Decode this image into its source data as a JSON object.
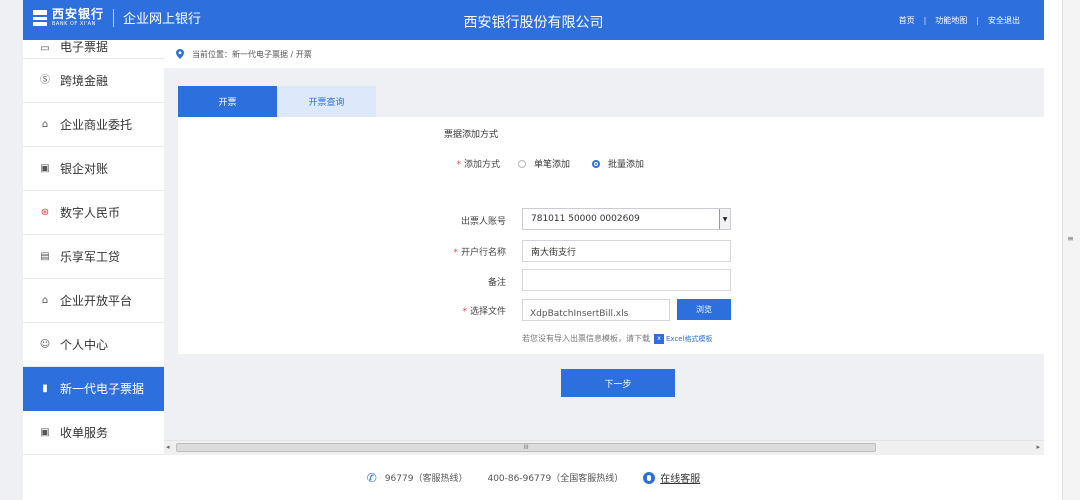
{
  "header": {
    "bank_name_cn": "西安银行",
    "bank_name_en": "BANK OF XI'AN",
    "portal_name": "企业网上银行",
    "company_name": "西安银行股份有限公司",
    "links": {
      "home": "首页",
      "sitemap": "功能地图",
      "logout": "安全退出"
    },
    "accent_color": "#2e6fde"
  },
  "sidebar": {
    "items": [
      {
        "label": "电子票据",
        "icon": "ticket-icon",
        "partial": true
      },
      {
        "label": "跨境金融",
        "icon": "dollar-circle-icon"
      },
      {
        "label": "企业商业委托",
        "icon": "bank-icon"
      },
      {
        "label": "银企对账",
        "icon": "chart-icon"
      },
      {
        "label": "数字人民币",
        "icon": "yuan-coin-icon"
      },
      {
        "label": "乐享军工贷",
        "icon": "card-icon"
      },
      {
        "label": "企业开放平台",
        "icon": "building-icon"
      },
      {
        "label": "个人中心",
        "icon": "user-icon"
      },
      {
        "label": "新一代电子票据",
        "icon": "bill-icon",
        "active": true
      },
      {
        "label": "收单服务",
        "icon": "receipt-icon"
      }
    ]
  },
  "breadcrumb": {
    "text": "当前位置：新一代电子票据 / 开票"
  },
  "tabs": [
    {
      "label": "开票",
      "active": true
    },
    {
      "label": "开票查询",
      "active": false
    }
  ],
  "form": {
    "section_title": "票据添加方式",
    "add_method_label": "添加方式",
    "add_method_options": [
      {
        "label": "单笔添加",
        "checked": false
      },
      {
        "label": "批量添加",
        "checked": true
      }
    ],
    "drawer_account_label": "出票人账号",
    "drawer_account_value": "781011 50000 0002609",
    "branch_label": "开户行名称",
    "branch_value": "南大街支行",
    "remark_label": "备注",
    "remark_value": "",
    "file_label": "选择文件",
    "file_value": "XdpBatchInsertBill.xls",
    "browse_label": "浏览",
    "hint_text": "若您没有导入出票信息模板，请下载",
    "excel_link": "Excel格式模板",
    "next_label": "下一步"
  },
  "scrollbar": {
    "thumb_label": "III"
  },
  "footer": {
    "hotline": "96779（客服热线）",
    "national_hotline": "400-86-96779（全国客服热线）",
    "online_service": "在线客服"
  }
}
